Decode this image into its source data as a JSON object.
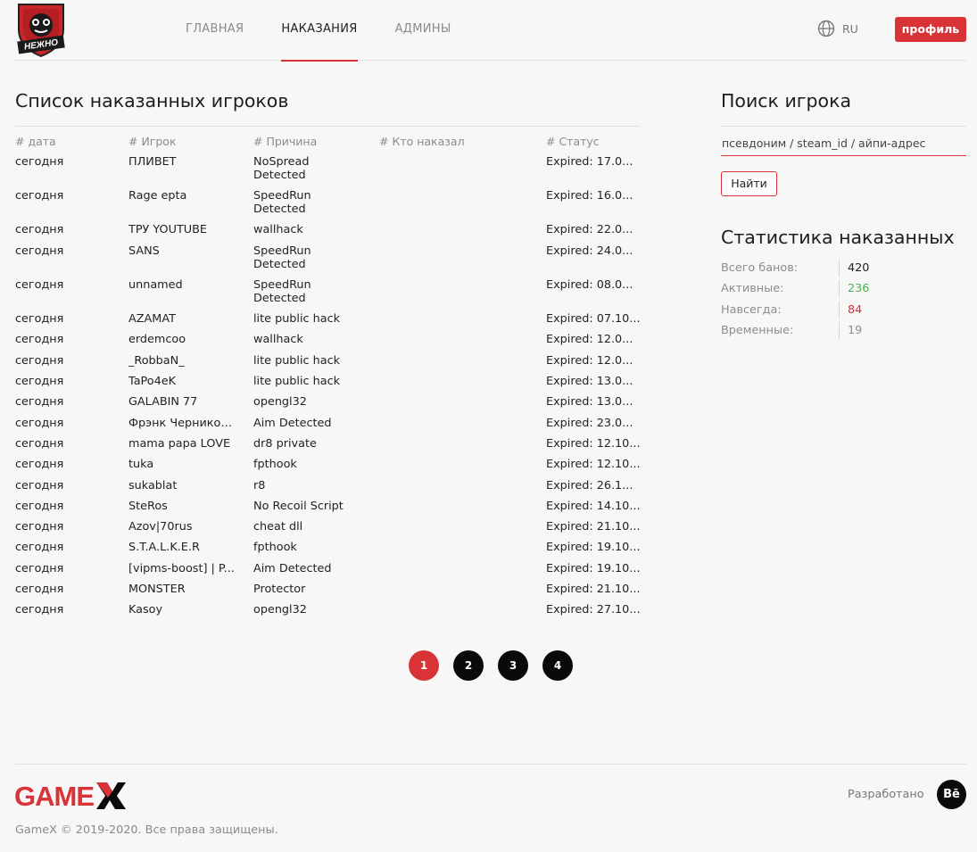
{
  "header": {
    "logo_text": "НЕЖНО",
    "nav": [
      {
        "label": "ГЛАВНАЯ",
        "active": false
      },
      {
        "label": "НАКАЗАНИЯ",
        "active": true
      },
      {
        "label": "АДМИНЫ",
        "active": false
      }
    ],
    "language": "RU",
    "profile_label": "профиль"
  },
  "bans": {
    "title": "Список наказанных игроков",
    "columns": {
      "date": "# дата",
      "player": "# Игрок",
      "reason": "# Причина",
      "admin": "# Кто наказал",
      "status": "# Статус"
    },
    "rows": [
      {
        "date": "сегодня",
        "player": "ПЛИВЕТ",
        "reason": "NoSpread Detected",
        "admin": "",
        "status": "Expired: 17.0..."
      },
      {
        "date": "сегодня",
        "player": "Rage epta",
        "reason": "SpeedRun Detected",
        "admin": "",
        "status": "Expired: 16.0..."
      },
      {
        "date": "сегодня",
        "player": "ТРУ YOUTUBE",
        "reason": "wallhack",
        "admin": "",
        "status": "Expired: 22.0..."
      },
      {
        "date": "сегодня",
        "player": "SANS",
        "reason": "SpeedRun Detected",
        "admin": "",
        "status": "Expired: 24.0..."
      },
      {
        "date": "сегодня",
        "player": "unnamed",
        "reason": "SpeedRun Detected",
        "admin": "",
        "status": "Expired: 08.0..."
      },
      {
        "date": "сегодня",
        "player": "AZAMAT",
        "reason": "lite public hack",
        "admin": "",
        "status": "Expired: 07.10..."
      },
      {
        "date": "сегодня",
        "player": "erdemcoo",
        "reason": "wallhack",
        "admin": "",
        "status": "Expired: 12.0..."
      },
      {
        "date": "сегодня",
        "player": "_RobbaN_",
        "reason": "lite public hack",
        "admin": "",
        "status": "Expired: 12.0..."
      },
      {
        "date": "сегодня",
        "player": "TaPo4eK",
        "reason": "lite public hack",
        "admin": "",
        "status": "Expired: 13.0..."
      },
      {
        "date": "сегодня",
        "player": "GALABIN 77",
        "reason": "opengl32",
        "admin": "",
        "status": "Expired: 13.0..."
      },
      {
        "date": "сегодня",
        "player": "Фрэнк Черников...",
        "reason": "Aim Detected",
        "admin": "",
        "status": "Expired: 23.0..."
      },
      {
        "date": "сегодня",
        "player": "mama papa LOVE",
        "reason": "dr8 private",
        "admin": "",
        "status": "Expired: 12.10..."
      },
      {
        "date": "сегодня",
        "player": "tuka",
        "reason": "fpthook",
        "admin": "",
        "status": "Expired: 12.10..."
      },
      {
        "date": "сегодня",
        "player": "sukablat",
        "reason": "r8",
        "admin": "",
        "status": "Expired: 26.1..."
      },
      {
        "date": "сегодня",
        "player": "SteRos",
        "reason": "No Recoil Script",
        "admin": "",
        "status": "Expired: 14.10..."
      },
      {
        "date": "сегодня",
        "player": "Azov|70rus",
        "reason": "cheat dll",
        "admin": "",
        "status": "Expired: 21.10..."
      },
      {
        "date": "сегодня",
        "player": "S.T.A.L.K.E.R",
        "reason": "fpthook",
        "admin": "",
        "status": "Expired: 19.10..."
      },
      {
        "date": "сегодня",
        "player": "[vipms-boost] | P...",
        "reason": "Aim Detected",
        "admin": "",
        "status": "Expired: 19.10..."
      },
      {
        "date": "сегодня",
        "player": "MONSTER",
        "reason": "Protector",
        "admin": "",
        "status": "Expired: 21.10..."
      },
      {
        "date": "сегодня",
        "player": "Kasoy",
        "reason": "opengl32",
        "admin": "",
        "status": "Expired: 27.10..."
      }
    ]
  },
  "pagination": {
    "pages": [
      "1",
      "2",
      "3",
      "4"
    ],
    "active": "1"
  },
  "search": {
    "title": "Поиск игрока",
    "placeholder": "псевдоним / steam_id / айпи-адрес",
    "button_label": "Найти"
  },
  "stats": {
    "title": "Статистика наказанных",
    "items": [
      {
        "label": "Всего банов:",
        "value": "420",
        "color": "#222222"
      },
      {
        "label": "Активные:",
        "value": "236",
        "color": "#4caf50"
      },
      {
        "label": "Навсегда:",
        "value": "84",
        "color": "#d93338"
      },
      {
        "label": "Временные:",
        "value": "19",
        "color": "#8c8c8c"
      }
    ]
  },
  "footer": {
    "brand": "GAMEX",
    "developed_label": "Разработано",
    "dev_icon": "Bē",
    "copyright": "GameX © 2019-2020. Все права защищены."
  },
  "colors": {
    "accent": "#d93338",
    "background": "#f7f7f7",
    "dark": "#0a0a0a"
  }
}
